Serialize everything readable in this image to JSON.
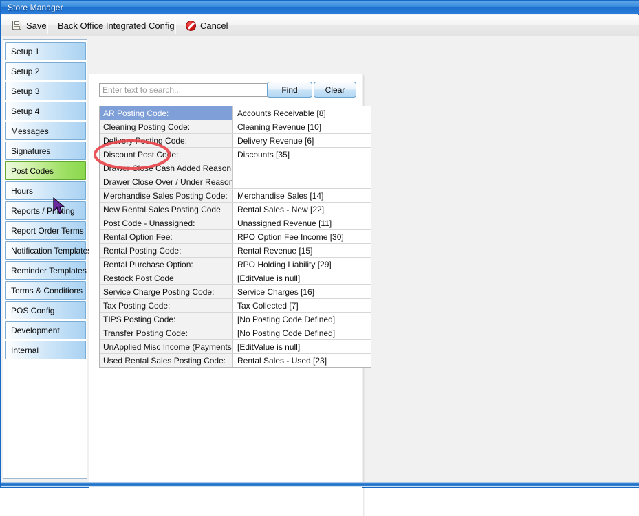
{
  "window": {
    "title": "Store Manager"
  },
  "toolbar": {
    "save_label": "Save",
    "config_label": "Back Office Integrated Config",
    "cancel_label": "Cancel",
    "save_icon": "floppy-disk-icon",
    "cancel_icon": "red-slash-icon"
  },
  "sidebar": {
    "items": [
      {
        "label": "Setup 1",
        "selected": false
      },
      {
        "label": "Setup 2",
        "selected": false
      },
      {
        "label": "Setup 3",
        "selected": false
      },
      {
        "label": "Setup 4",
        "selected": false
      },
      {
        "label": "Messages",
        "selected": false
      },
      {
        "label": "Signatures",
        "selected": false
      },
      {
        "label": "Post Codes",
        "selected": true
      },
      {
        "label": "Hours",
        "selected": false
      },
      {
        "label": "Reports / Printing",
        "selected": false
      },
      {
        "label": "Report Order Terms",
        "selected": false
      },
      {
        "label": "Notification Templates",
        "selected": false
      },
      {
        "label": "Reminder Templates",
        "selected": false
      },
      {
        "label": "Terms & Conditions",
        "selected": false
      },
      {
        "label": "POS Config",
        "selected": false
      },
      {
        "label": "Development",
        "selected": false
      },
      {
        "label": "Internal",
        "selected": false
      }
    ],
    "selected_color": "#9fe065"
  },
  "search": {
    "value": "",
    "placeholder": "Enter text to search...",
    "find_label": "Find",
    "clear_label": "Clear"
  },
  "grid": {
    "selected_row_index": 0,
    "selected_row_color": "#7f9fd9",
    "rows": [
      {
        "key": "AR Posting Code:",
        "value": "Accounts Receivable [8]"
      },
      {
        "key": "Cleaning Posting Code:",
        "value": "Cleaning Revenue [10]"
      },
      {
        "key": "Delivery Posting Code:",
        "value": "Delivery Revenue [6]"
      },
      {
        "key": "Discount Post Code:",
        "value": "Discounts [35]"
      },
      {
        "key": "Drawer Close Cash Added Reason:",
        "value": ""
      },
      {
        "key": "Drawer Close Over / Under Reason:",
        "value": ""
      },
      {
        "key": "Merchandise Sales Posting Code:",
        "value": "Merchandise Sales [14]"
      },
      {
        "key": "New Rental Sales Posting Code",
        "value": "Rental Sales - New [22]"
      },
      {
        "key": "Post Code - Unassigned:",
        "value": "Unassigned Revenue [11]"
      },
      {
        "key": "Rental Option Fee:",
        "value": "RPO Option Fee Income [30]"
      },
      {
        "key": "Rental Posting Code:",
        "value": "Rental Revenue [15]"
      },
      {
        "key": "Rental Purchase Option:",
        "value": "RPO Holding Liability [29]"
      },
      {
        "key": "Restock Post Code",
        "value": "[EditValue is null]"
      },
      {
        "key": "Service Charge Posting Code:",
        "value": "Service Charges [16]"
      },
      {
        "key": "Tax Posting Code:",
        "value": "Tax Collected [7]"
      },
      {
        "key": "TIPS Posting Code:",
        "value": "[No Posting Code Defined]"
      },
      {
        "key": "Transfer Posting Code:",
        "value": "[No Posting Code Defined]"
      },
      {
        "key": "UnApplied Misc Income (Payments):",
        "value": "[EditValue is null]"
      },
      {
        "key": "Used Rental Sales Posting Code:",
        "value": "Rental Sales - Used [23]"
      }
    ]
  },
  "annotation": {
    "kind": "red-ellipse-highlight",
    "target_row": "Discount Post Code:",
    "color": "#e8474c"
  },
  "cursor": {
    "kind": "arrow-pointer",
    "color": "#6a2a9e"
  }
}
